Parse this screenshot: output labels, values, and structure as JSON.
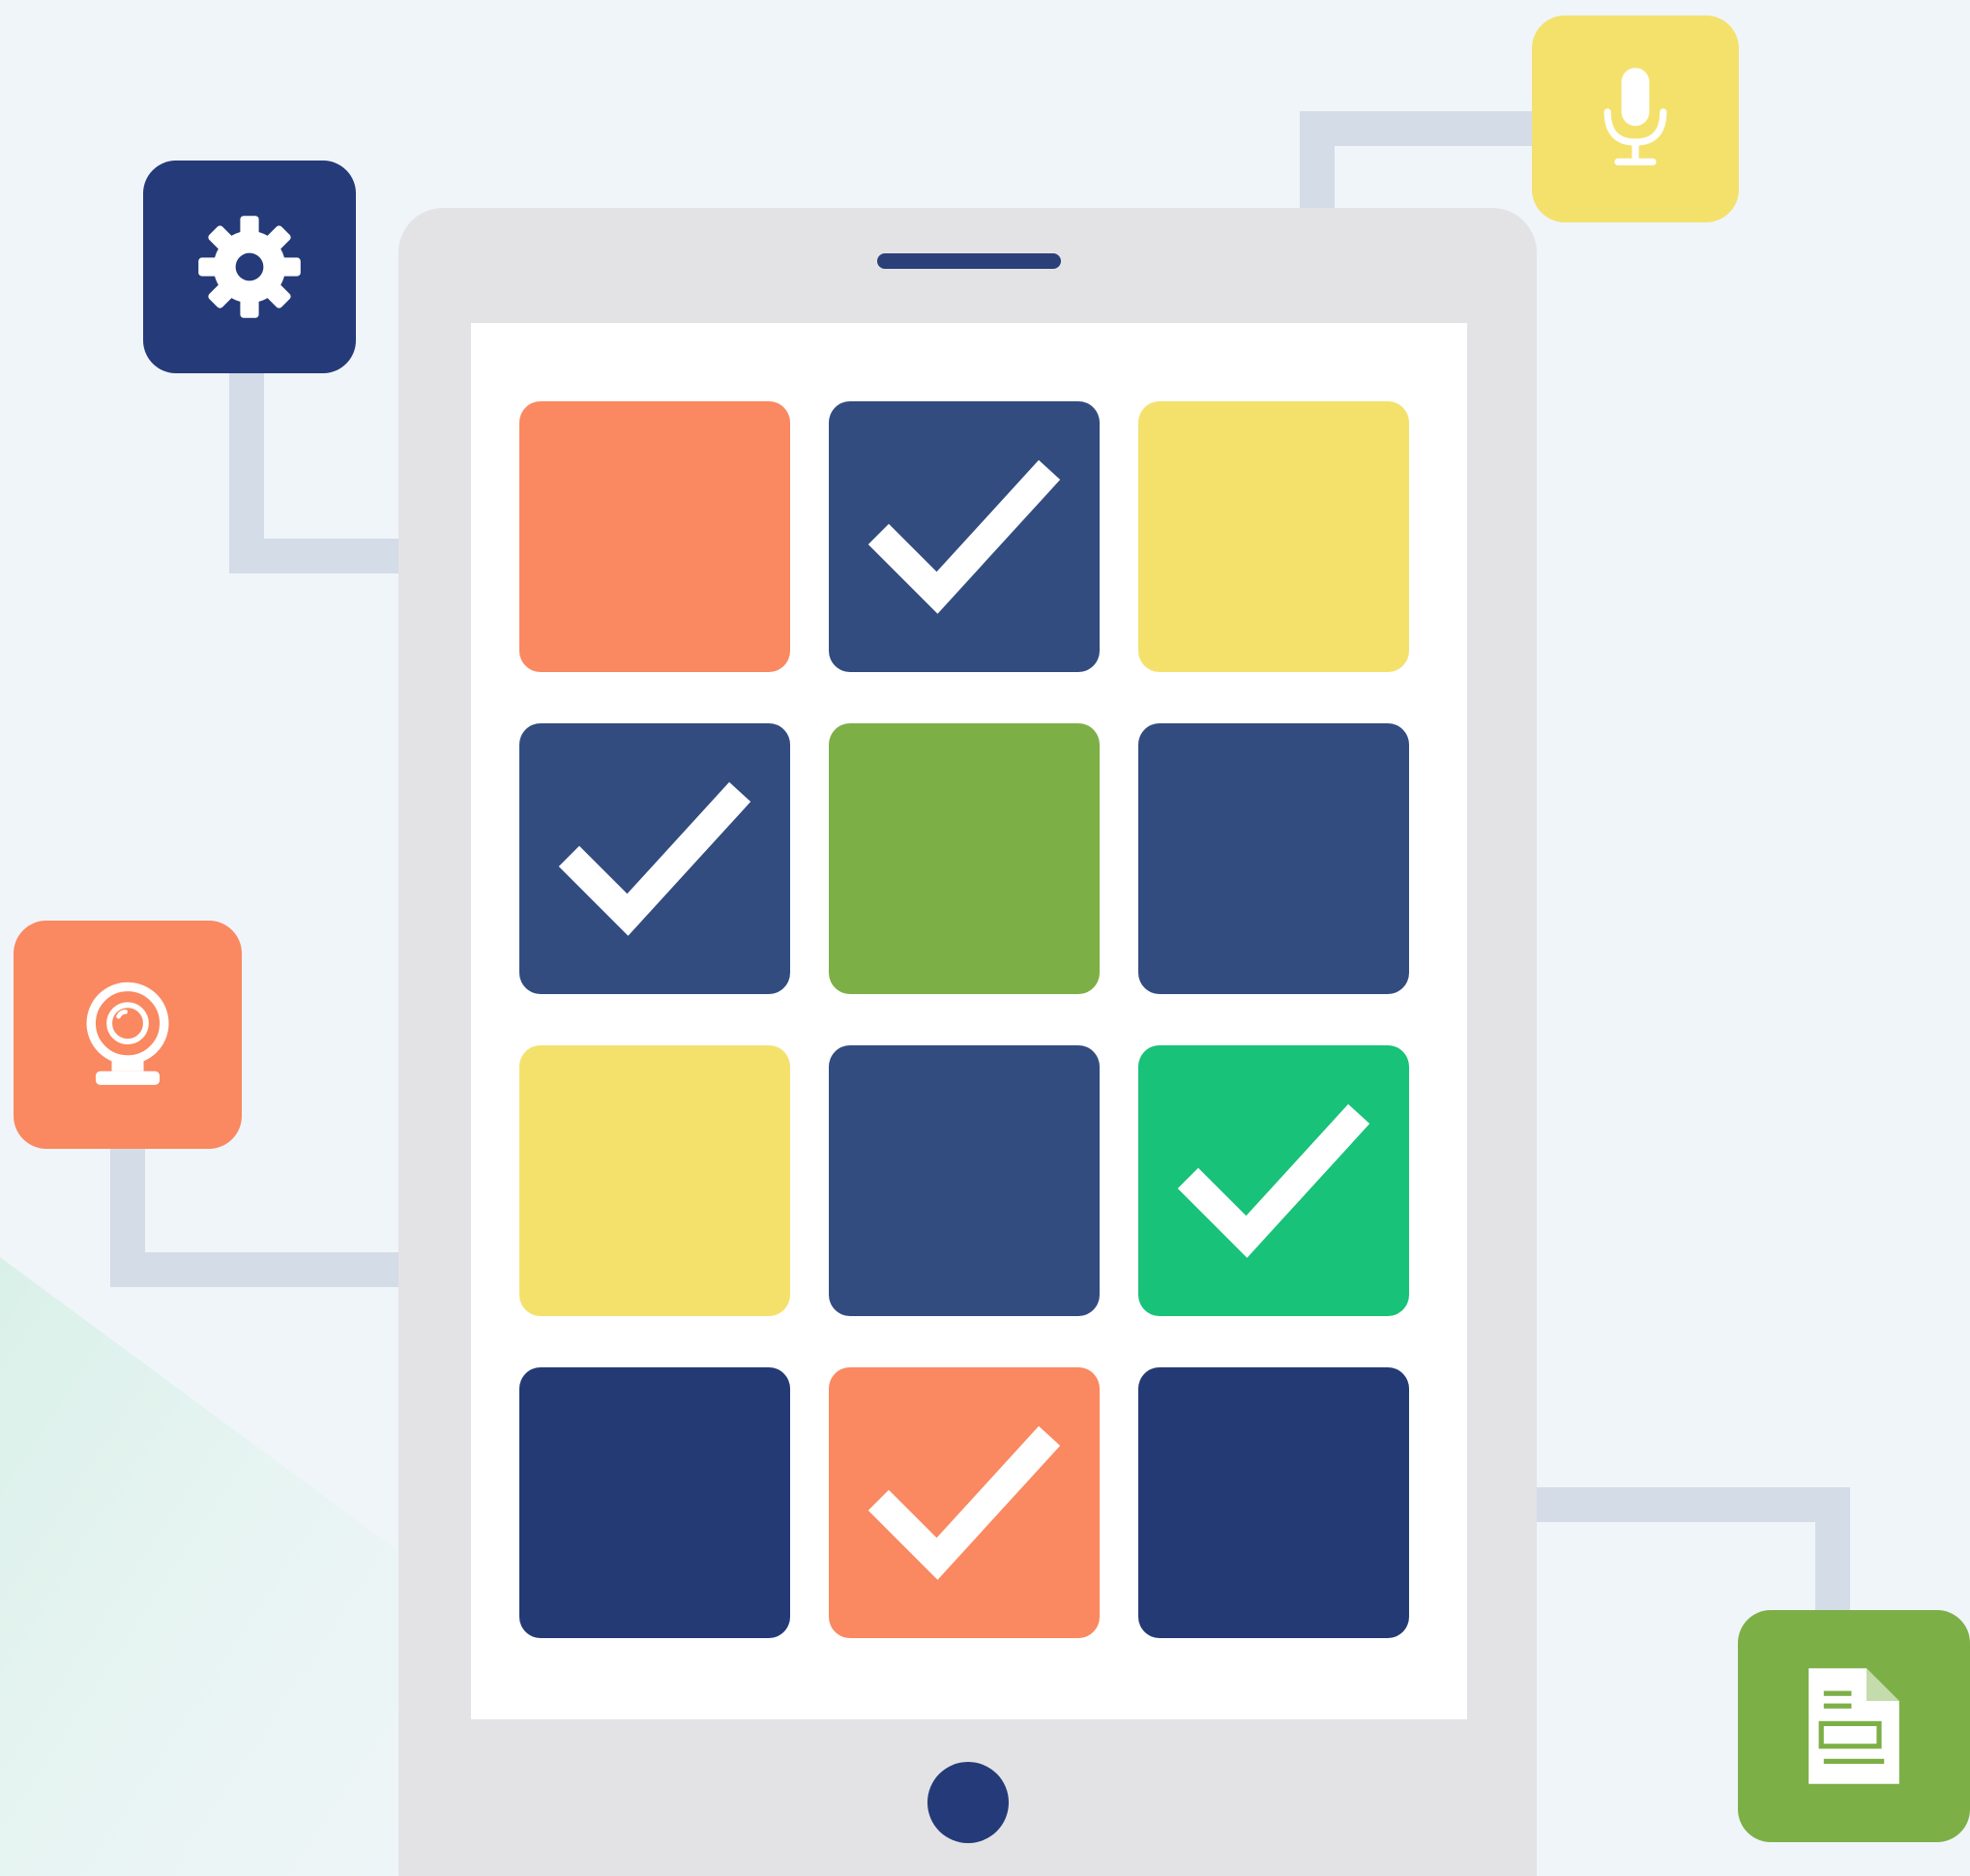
{
  "colors": {
    "background": "#f0f5fa",
    "tablet_frame": "#e3e3e5",
    "screen": "#ffffff",
    "navy": "#324c80",
    "navy_dark": "#243a74",
    "orange": "#fa8860",
    "yellow": "#f4e16c",
    "olive_green": "#7daf47",
    "bright_green": "#18c278",
    "connector": "#d4dce8"
  },
  "tablet": {
    "grid_columns": 3,
    "grid_rows": 4,
    "tiles": [
      {
        "color": "orange",
        "checked": false
      },
      {
        "color": "navy",
        "checked": true
      },
      {
        "color": "yellow",
        "checked": false
      },
      {
        "color": "navy",
        "checked": true
      },
      {
        "color": "olive_green",
        "checked": false
      },
      {
        "color": "navy",
        "checked": false
      },
      {
        "color": "yellow",
        "checked": false
      },
      {
        "color": "navy",
        "checked": false
      },
      {
        "color": "bright_green",
        "checked": true
      },
      {
        "color": "navy_dark",
        "checked": false
      },
      {
        "color": "orange",
        "checked": true
      },
      {
        "color": "navy_dark",
        "checked": false
      }
    ]
  },
  "app_icons": [
    {
      "icon": "gear-icon",
      "color": "#253a78"
    },
    {
      "icon": "microphone-icon",
      "color": "#f4e16c"
    },
    {
      "icon": "webcam-icon",
      "color": "#fa8860"
    },
    {
      "icon": "document-icon",
      "color": "#7daf47"
    }
  ]
}
